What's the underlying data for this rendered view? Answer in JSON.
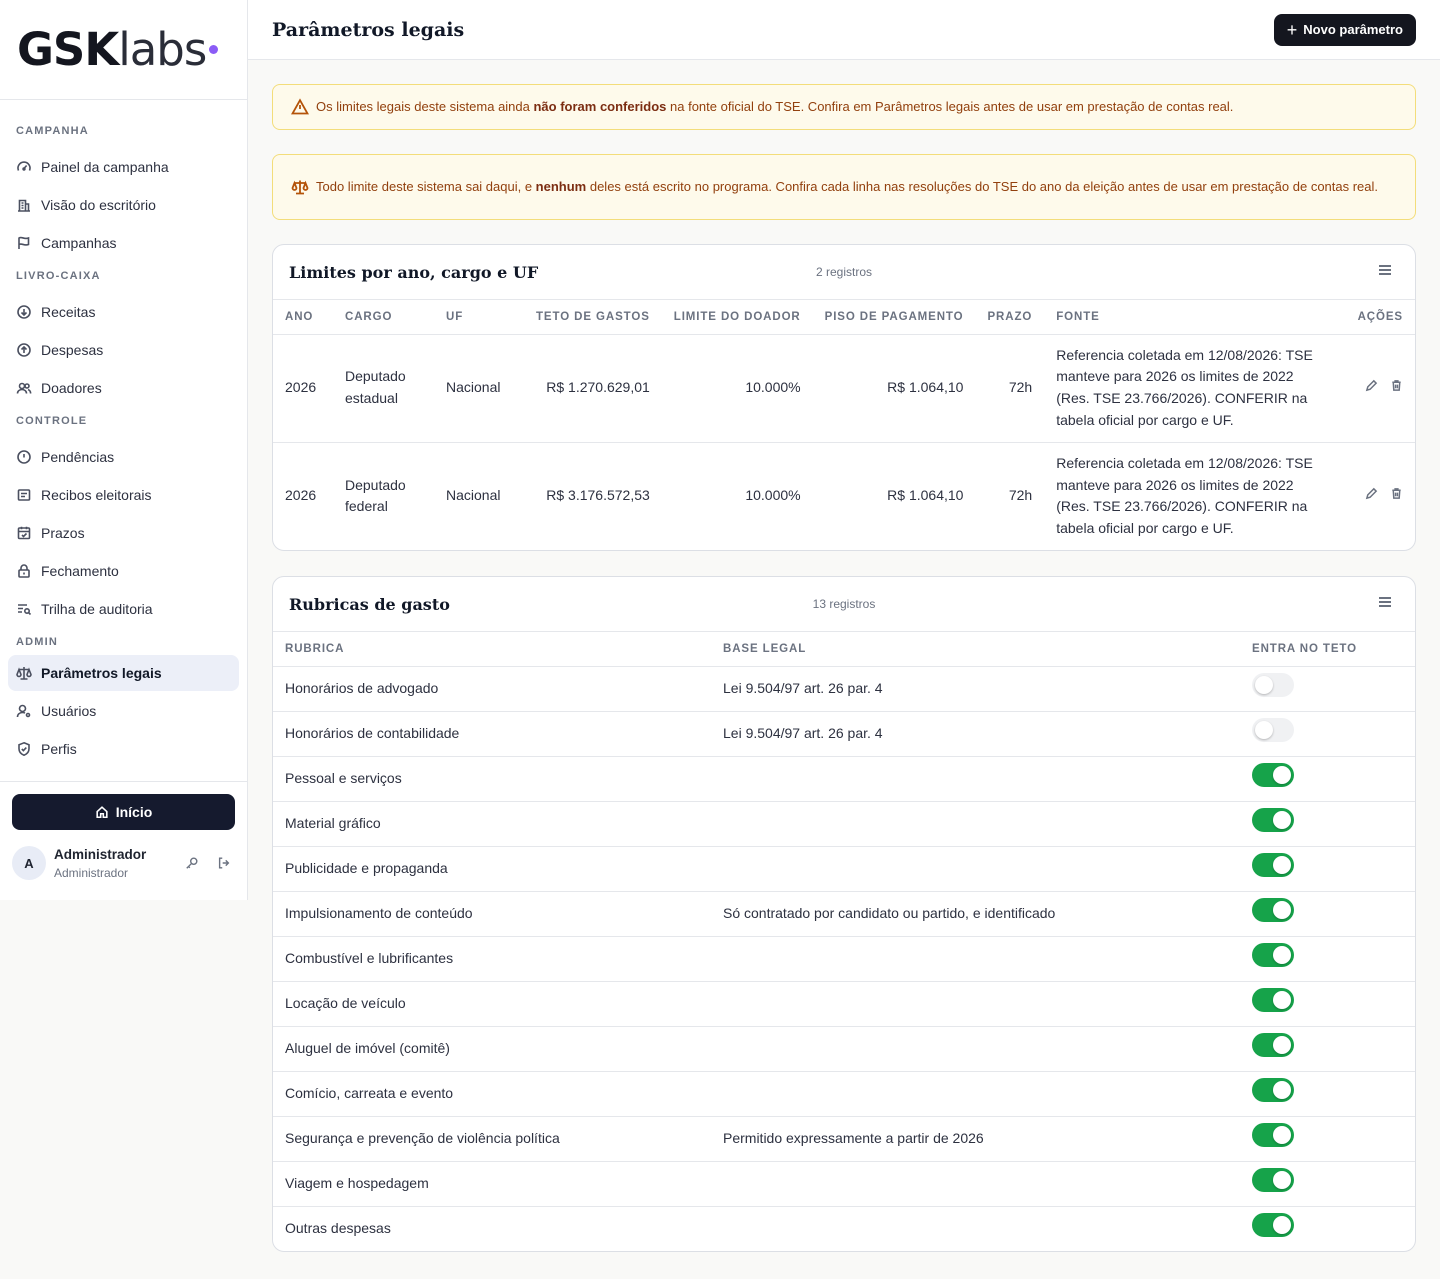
{
  "brand": {
    "bold": "GSK",
    "light": "labs"
  },
  "colors": {
    "accent": "#8b5cf6",
    "primary_dark": "#151a2e",
    "toggle_on": "#16a34a",
    "warning_bg": "#fefaeb"
  },
  "sidebar": {
    "sections": [
      {
        "title": "CAMPANHA",
        "items": [
          {
            "label": "Painel da campanha",
            "icon": "gauge-icon"
          },
          {
            "label": "Visão do escritório",
            "icon": "building-icon"
          },
          {
            "label": "Campanhas",
            "icon": "flag-icon"
          }
        ]
      },
      {
        "title": "LIVRO-CAIXA",
        "items": [
          {
            "label": "Receitas",
            "icon": "arrow-down-circle-icon"
          },
          {
            "label": "Despesas",
            "icon": "arrow-up-circle-icon"
          },
          {
            "label": "Doadores",
            "icon": "users-icon"
          }
        ]
      },
      {
        "title": "CONTROLE",
        "items": [
          {
            "label": "Pendências",
            "icon": "alert-circle-icon"
          },
          {
            "label": "Recibos eleitorais",
            "icon": "receipt-icon"
          },
          {
            "label": "Prazos",
            "icon": "calendar-check-icon"
          },
          {
            "label": "Fechamento",
            "icon": "lock-icon"
          },
          {
            "label": "Trilha de auditoria",
            "icon": "list-search-icon"
          }
        ]
      },
      {
        "title": "ADMIN",
        "items": [
          {
            "label": "Parâmetros legais",
            "icon": "scale-icon",
            "active": true
          },
          {
            "label": "Usuários",
            "icon": "user-cog-icon"
          },
          {
            "label": "Perfis",
            "icon": "shield-check-icon"
          }
        ]
      }
    ],
    "home_label": "Início",
    "user": {
      "initial": "A",
      "name": "Administrador",
      "role": "Administrador"
    }
  },
  "header": {
    "title": "Parâmetros legais",
    "new_button": "Novo parâmetro"
  },
  "alerts": {
    "first": {
      "pre": "Os limites legais deste sistema ainda ",
      "bold": "não foram conferidos",
      "post": " na fonte oficial do TSE. Confira em Parâmetros legais antes de usar em prestação de contas real."
    },
    "second": {
      "pre": "Todo limite deste sistema sai daqui, e ",
      "bold": "nenhum",
      "post": " deles está escrito no programa. Confira cada linha nas resoluções do TSE do ano da eleição antes de usar em prestação de contas real."
    }
  },
  "limits": {
    "title": "Limites por ano, cargo e UF",
    "count": "2 registros",
    "columns": [
      "ANO",
      "CARGO",
      "UF",
      "TETO DE GASTOS",
      "LIMITE DO DOADOR",
      "PISO DE PAGAMENTO",
      "PRAZO",
      "FONTE",
      "AÇÕES"
    ],
    "rows": [
      {
        "ano": "2026",
        "cargo": "Deputado estadual",
        "uf": "Nacional",
        "teto": "R$ 1.270.629,01",
        "limite": "10.000%",
        "piso": "R$ 1.064,10",
        "prazo": "72h",
        "fonte": "Referencia coletada em 12/08/2026: TSE manteve para 2026 os limites de 2022 (Res. TSE 23.766/2026). CONFERIR na tabela oficial por cargo e UF."
      },
      {
        "ano": "2026",
        "cargo": "Deputado federal",
        "uf": "Nacional",
        "teto": "R$ 3.176.572,53",
        "limite": "10.000%",
        "piso": "R$ 1.064,10",
        "prazo": "72h",
        "fonte": "Referencia coletada em 12/08/2026: TSE manteve para 2026 os limites de 2022 (Res. TSE 23.766/2026). CONFERIR na tabela oficial por cargo e UF."
      }
    ]
  },
  "rubricas": {
    "title": "Rubricas de gasto",
    "count": "13 registros",
    "columns": [
      "RUBRICA",
      "BASE LEGAL",
      "ENTRA NO TETO"
    ],
    "rows": [
      {
        "rubrica": "Honorários de advogado",
        "base": "Lei 9.504/97 art. 26 par. 4",
        "teto": false
      },
      {
        "rubrica": "Honorários de contabilidade",
        "base": "Lei 9.504/97 art. 26 par. 4",
        "teto": false
      },
      {
        "rubrica": "Pessoal e serviços",
        "base": "",
        "teto": true
      },
      {
        "rubrica": "Material gráfico",
        "base": "",
        "teto": true
      },
      {
        "rubrica": "Publicidade e propaganda",
        "base": "",
        "teto": true
      },
      {
        "rubrica": "Impulsionamento de conteúdo",
        "base": "Só contratado por candidato ou partido, e identificado",
        "teto": true
      },
      {
        "rubrica": "Combustível e lubrificantes",
        "base": "",
        "teto": true
      },
      {
        "rubrica": "Locação de veículo",
        "base": "",
        "teto": true
      },
      {
        "rubrica": "Aluguel de imóvel (comitê)",
        "base": "",
        "teto": true
      },
      {
        "rubrica": "Comício, carreata e evento",
        "base": "",
        "teto": true
      },
      {
        "rubrica": "Segurança e prevenção de violência política",
        "base": "Permitido expressamente a partir de 2026",
        "teto": true
      },
      {
        "rubrica": "Viagem e hospedagem",
        "base": "",
        "teto": true
      },
      {
        "rubrica": "Outras despesas",
        "base": "",
        "teto": true
      }
    ]
  }
}
